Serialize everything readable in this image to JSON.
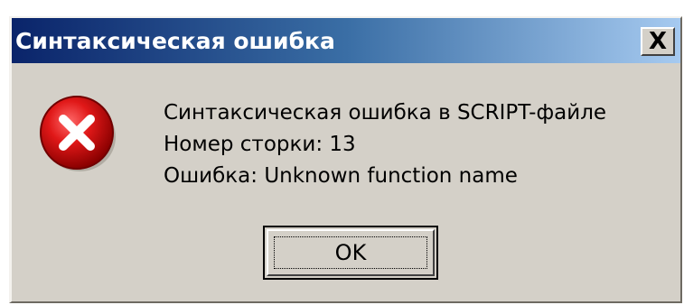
{
  "dialog": {
    "title": "Синтаксическая ошибка",
    "close_label": "X",
    "icon": "error-icon",
    "message_lines": [
      "Синтаксическая ошибка в SCRIPT-файле",
      "Номер сторки: 13",
      "Ошибка: Unknown function name"
    ],
    "ok_label": "OK"
  },
  "colors": {
    "face": "#d4d0c8",
    "title_start": "#0a246a",
    "title_end": "#a6caf0",
    "error_red": "#cc0000"
  }
}
